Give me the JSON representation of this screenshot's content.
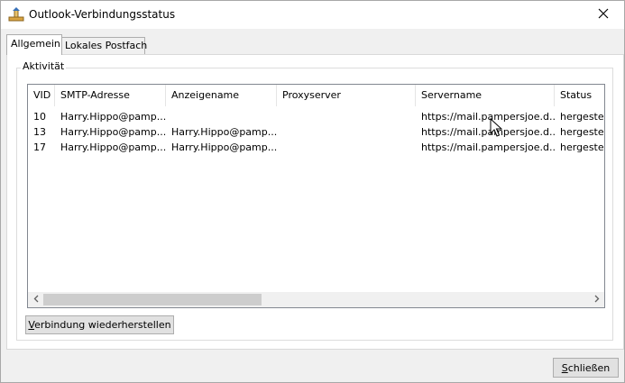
{
  "window": {
    "title": "Outlook-Verbindungsstatus"
  },
  "tabs": [
    {
      "label": "Allgemein",
      "active": true
    },
    {
      "label": "Lokales Postfach",
      "active": false
    }
  ],
  "group": {
    "label": "Aktivität"
  },
  "table": {
    "columns": [
      "VID",
      "SMTP-Adresse",
      "Anzeigename",
      "Proxyserver",
      "Servername",
      "Status"
    ],
    "rows": [
      [
        "10",
        "Harry.Hippo@pamp...",
        "",
        "",
        "https://mail.pampersjoe.d...",
        "hergestel"
      ],
      [
        "13",
        "Harry.Hippo@pamp...",
        "Harry.Hippo@pamp...",
        "",
        "https://mail.pampersjoe.d...",
        "hergestel"
      ],
      [
        "17",
        "Harry.Hippo@pamp...",
        "Harry.Hippo@pamp...",
        "",
        "https://mail.pampersjoe.d...",
        "hergestel"
      ]
    ]
  },
  "buttons": {
    "reconnect_underlined": "V",
    "reconnect_rest": "erbindung wiederherstellen",
    "close_underlined": "S",
    "close_rest": "chließen"
  },
  "icons": {
    "app": "outlook-connection-icon",
    "close": "close-icon",
    "scroll_left": "chevron-left-icon",
    "scroll_right": "chevron-right-icon"
  }
}
